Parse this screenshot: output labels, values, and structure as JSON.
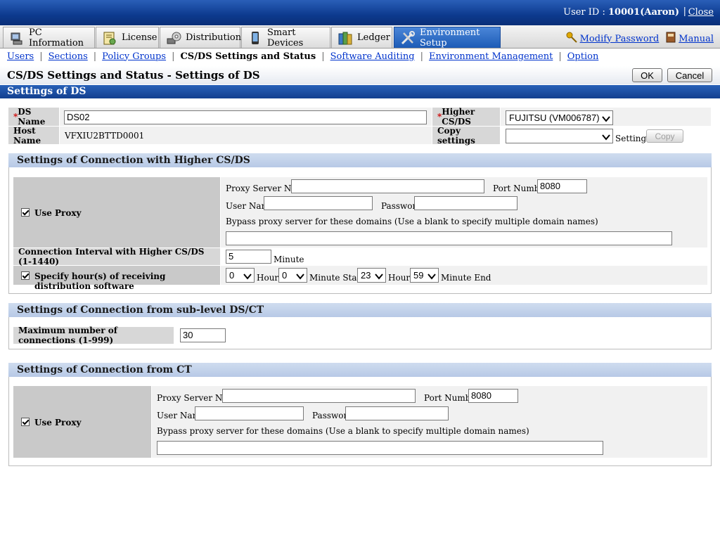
{
  "header": {
    "user_label": "User ID : ",
    "user_value": "10001(Aaron)",
    "sep": "|",
    "close": "Close"
  },
  "menu": {
    "tabs": [
      {
        "label": "PC Information",
        "icon": "pc-icon"
      },
      {
        "label": "License",
        "icon": "license-icon"
      },
      {
        "label": "Distribution",
        "icon": "distribution-icon"
      },
      {
        "label": "Smart Devices",
        "icon": "smart-device-icon"
      },
      {
        "label": "Ledger",
        "icon": "ledger-icon"
      },
      {
        "label": "Environment Setup",
        "icon": "tools-icon"
      }
    ],
    "active": "Environment Setup",
    "modify_password": "Modify Password",
    "manual": "Manual"
  },
  "subnav": {
    "items": [
      "Users",
      "Sections",
      "Policy Groups",
      "CS/DS Settings and Status",
      "Software Auditing",
      "Environment Management",
      "Option"
    ],
    "current": "CS/DS Settings and Status"
  },
  "page": {
    "title": "CS/DS Settings and Status - Settings of DS",
    "ok": "OK",
    "cancel": "Cancel",
    "section": "Settings of DS"
  },
  "ds": {
    "req_mark": "*",
    "ds_name_label": "DS Name",
    "ds_name_value": "DS02",
    "higher_label": "Higher CS/DS",
    "higher_value": "FUJITSU (VM006787)",
    "host_label": "Host Name",
    "host_value": "VFXIU2BTTD0001",
    "copy_label": "Copy settings",
    "copy_value": "",
    "settings_text": "Settings",
    "copy_button": "Copy"
  },
  "higher_conn": {
    "title": "Settings of Connection with Higher CS/DS",
    "use_proxy": "Use Proxy",
    "proxy_server_label": "Proxy Server Name",
    "proxy_server_value": "",
    "port_label": "Port Number",
    "port_value": "8080",
    "user_label": "User Name",
    "user_value": "",
    "password_label": "Password",
    "password_value": "",
    "bypass_label": "Bypass proxy server for these domains (Use a blank to specify multiple domain names)",
    "bypass_value": "",
    "interval_label": "Connection Interval with Higher CS/DS (1-1440)",
    "interval_value": "5",
    "interval_unit": "Minute",
    "specify_hours_label": "Specify hour(s) of receiving distribution software",
    "start_hour": "0",
    "hour_text": "Hour",
    "start_min": "0",
    "minute_start_text": "Minute Start",
    "end_hour": "23",
    "end_min": "59",
    "minute_end_text": "Minute End"
  },
  "sublevel": {
    "title": "Settings of Connection from sub-level DS/CT",
    "max_label": "Maximum number of connections (1-999)",
    "max_value": "30"
  },
  "ct_conn": {
    "title": "Settings of Connection from CT",
    "use_proxy": "Use Proxy",
    "proxy_server_label": "Proxy Server Name",
    "proxy_server_value": "",
    "port_label": "Port Number",
    "port_value": "8080",
    "user_label": "User Name",
    "user_value": "",
    "password_label": "Password",
    "password_value": "",
    "bypass_label": "Bypass proxy server for these domains (Use a blank to specify multiple domain names)",
    "bypass_value": ""
  }
}
